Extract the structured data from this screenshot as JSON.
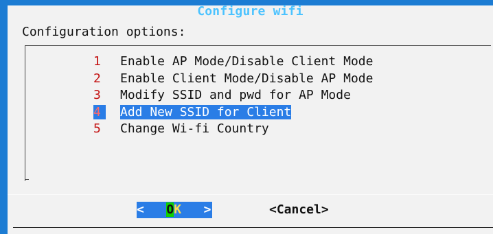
{
  "dialog": {
    "title": "Configure wifi",
    "prompt": "Configuration options:"
  },
  "menu": {
    "items": [
      {
        "number": "1",
        "label": "Enable AP Mode/Disable Client Mode",
        "selected": false
      },
      {
        "number": "2",
        "label": "Enable Client Mode/Disable AP Mode",
        "selected": false
      },
      {
        "number": "3",
        "label": "Modify SSID and pwd for AP Mode",
        "selected": false
      },
      {
        "number": "4",
        "label": "Add New SSID for Client",
        "selected": true
      },
      {
        "number": "5",
        "label": "Change Wi-fi Country",
        "selected": false
      }
    ]
  },
  "buttons": {
    "ok": {
      "left_bracket": "<",
      "hotkey": "O",
      "rest": "K",
      "right_bracket": ">"
    },
    "cancel_label": "<Cancel>"
  },
  "colors": {
    "background": "#1c7cd3",
    "dialog": "#f2f2f2",
    "title": "#4cc3ff",
    "selection": "#2a7de6",
    "number": "#c31212",
    "hotkey": "#10d000"
  }
}
